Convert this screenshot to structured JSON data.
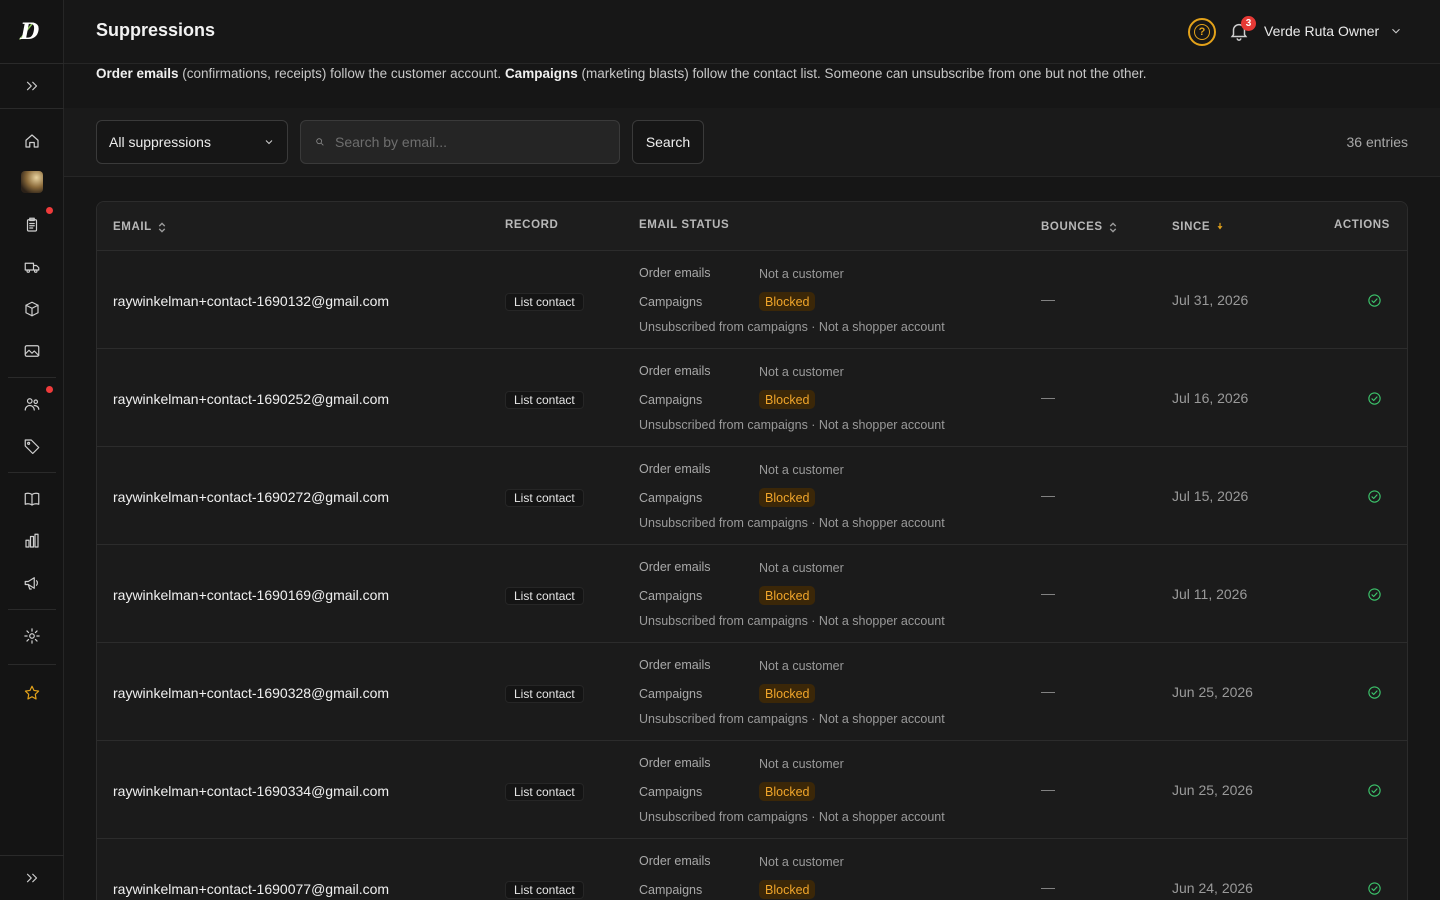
{
  "app": {
    "page_title": "Suppressions"
  },
  "header": {
    "help_symbol": "?",
    "notifications_count": "3",
    "user_name": "Verde Ruta Owner"
  },
  "info": {
    "order_label": "Order emails",
    "order_desc": " (confirmations, receipts) follow the customer account. ",
    "campaign_label": "Campaigns",
    "campaign_desc": " (marketing blasts) follow the contact list. Someone can unsubscribe from one but not the other."
  },
  "toolbar": {
    "filter_value": "All suppressions",
    "search_placeholder": "Search by email...",
    "search_button": "Search",
    "entries": "36 entries"
  },
  "table": {
    "headers": {
      "email": "EMAIL",
      "record": "RECORD",
      "email_status": "EMAIL STATUS",
      "bounces": "BOUNCES",
      "since": "SINCE",
      "actions": "ACTIONS"
    },
    "rows": [
      {
        "email": "raywinkelman+contact-1690132@gmail.com",
        "record": "List contact",
        "order_label": "Order emails",
        "order_value": "Not a customer",
        "campaign_label": "Campaigns",
        "campaign_value": "Blocked",
        "note": "Unsubscribed from campaigns · Not a shopper account",
        "bounces": "—",
        "since": "Jul 31, 2026"
      },
      {
        "email": "raywinkelman+contact-1690252@gmail.com",
        "record": "List contact",
        "order_label": "Order emails",
        "order_value": "Not a customer",
        "campaign_label": "Campaigns",
        "campaign_value": "Blocked",
        "note": "Unsubscribed from campaigns · Not a shopper account",
        "bounces": "—",
        "since": "Jul 16, 2026"
      },
      {
        "email": "raywinkelman+contact-1690272@gmail.com",
        "record": "List contact",
        "order_label": "Order emails",
        "order_value": "Not a customer",
        "campaign_label": "Campaigns",
        "campaign_value": "Blocked",
        "note": "Unsubscribed from campaigns · Not a shopper account",
        "bounces": "—",
        "since": "Jul 15, 2026"
      },
      {
        "email": "raywinkelman+contact-1690169@gmail.com",
        "record": "List contact",
        "order_label": "Order emails",
        "order_value": "Not a customer",
        "campaign_label": "Campaigns",
        "campaign_value": "Blocked",
        "note": "Unsubscribed from campaigns · Not a shopper account",
        "bounces": "—",
        "since": "Jul 11, 2026"
      },
      {
        "email": "raywinkelman+contact-1690328@gmail.com",
        "record": "List contact",
        "order_label": "Order emails",
        "order_value": "Not a customer",
        "campaign_label": "Campaigns",
        "campaign_value": "Blocked",
        "note": "Unsubscribed from campaigns · Not a shopper account",
        "bounces": "—",
        "since": "Jun 25, 2026"
      },
      {
        "email": "raywinkelman+contact-1690334@gmail.com",
        "record": "List contact",
        "order_label": "Order emails",
        "order_value": "Not a customer",
        "campaign_label": "Campaigns",
        "campaign_value": "Blocked",
        "note": "Unsubscribed from campaigns · Not a shopper account",
        "bounces": "—",
        "since": "Jun 25, 2026"
      },
      {
        "email": "raywinkelman+contact-1690077@gmail.com",
        "record": "List contact",
        "order_label": "Order emails",
        "order_value": "Not a customer",
        "campaign_label": "Campaigns",
        "campaign_value": "Blocked",
        "note": "",
        "bounces": "—",
        "since": "Jun 24, 2026"
      }
    ]
  },
  "colors": {
    "accent": "#e3a21a",
    "blocked_text": "#f0a52a",
    "success": "#3cc36b",
    "badge": "#e53935"
  },
  "icons": {
    "sidebar": [
      "expand-icon",
      "home-icon",
      "avatar",
      "orders-icon",
      "truck-icon",
      "box-icon",
      "image-icon",
      "customers-icon",
      "tag-icon",
      "book-icon",
      "analytics-icon",
      "megaphone-icon",
      "gear-icon",
      "star-icon",
      "expand-icon"
    ]
  }
}
